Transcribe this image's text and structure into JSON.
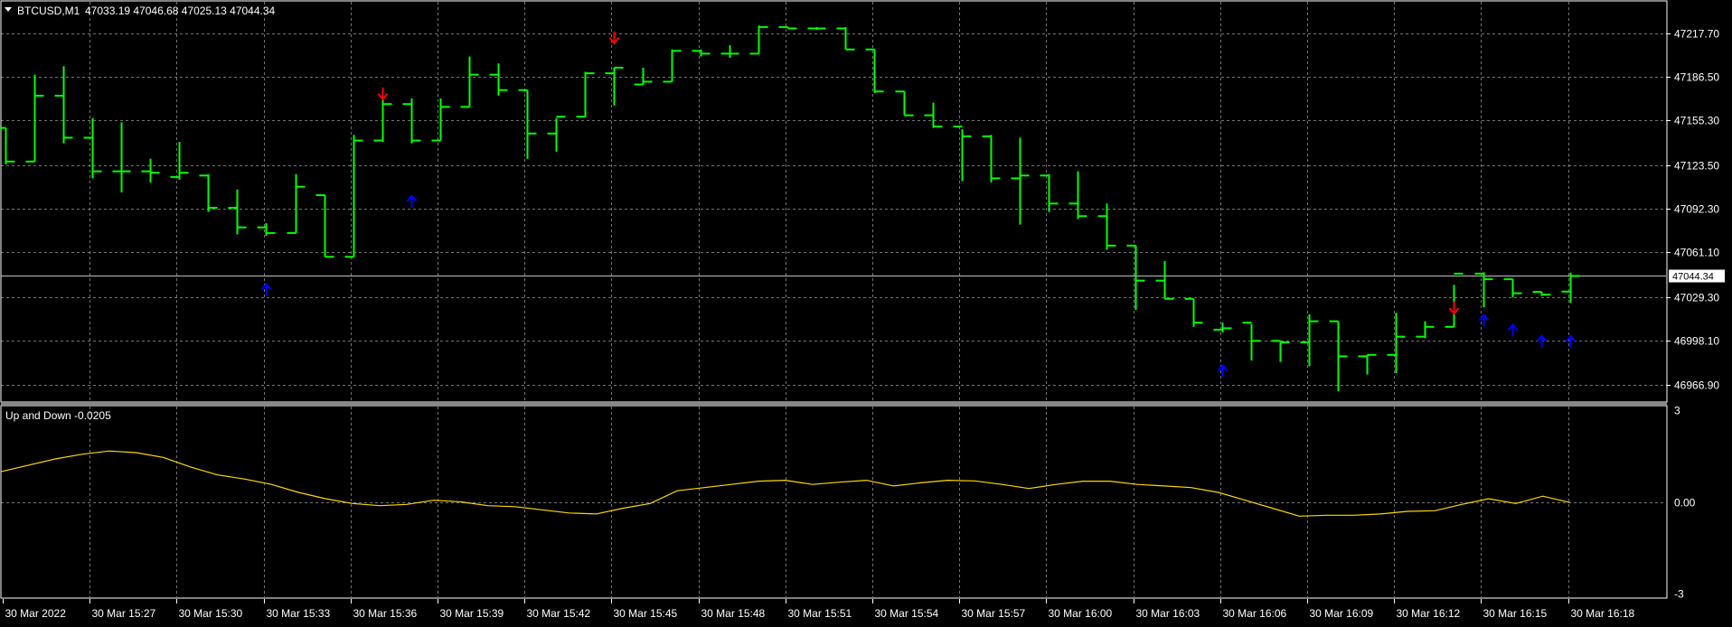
{
  "header": {
    "symbol_timeframe": "BTCUSD,M1",
    "ohlc": "47033.19 47046.68 47025.13 47044.34"
  },
  "indicator": {
    "label": "Up and Down -0.0205"
  },
  "colors": {
    "background": "#000000",
    "grid": "#c0c0c0",
    "bar": "#00ff00",
    "arrow_up": "#0000ff",
    "arrow_down": "#ff0000",
    "indicator_line": "#ffd700",
    "price_line": "#c0c0c0",
    "text": "#ffffff"
  },
  "chart_data": [
    {
      "type": "ohlc",
      "price_axis": {
        "ylim": [
          46955,
          47240
        ],
        "ticks": [
          "47217.70",
          "47186.50",
          "47155.30",
          "47123.50",
          "47092.30",
          "47061.10",
          "47029.30",
          "46998.10",
          "46966.90"
        ],
        "tick_values": [
          47217.7,
          47186.5,
          47155.3,
          47123.5,
          47092.3,
          47061.1,
          47029.3,
          46998.1,
          46966.9
        ],
        "current_price_label": "47044.34",
        "current_price": 47044.34
      },
      "bars": [
        {
          "o": 47150,
          "h": 47150,
          "l": 47124,
          "c": 47126
        },
        {
          "o": 47126,
          "h": 47188,
          "l": 47126,
          "c": 47173
        },
        {
          "o": 47173,
          "h": 47194,
          "l": 47139,
          "c": 47143
        },
        {
          "o": 47143,
          "h": 47157,
          "l": 47114,
          "c": 47119
        },
        {
          "o": 47119,
          "h": 47154,
          "l": 47104,
          "c": 47119
        },
        {
          "o": 47119,
          "h": 47128,
          "l": 47111,
          "c": 47118
        },
        {
          "o": 47115,
          "h": 47140,
          "l": 47113,
          "c": 47118
        },
        {
          "o": 47116,
          "h": 47117,
          "l": 47090,
          "c": 47093
        },
        {
          "o": 47093,
          "h": 47106,
          "l": 47074,
          "c": 47079
        },
        {
          "o": 47079,
          "h": 47082,
          "l": 47073,
          "c": 47075
        },
        {
          "o": 47075,
          "h": 47117,
          "l": 47075,
          "c": 47108
        },
        {
          "o": 47102,
          "h": 47102,
          "l": 47058,
          "c": 47058
        },
        {
          "o": 47058,
          "h": 47145,
          "l": 47058,
          "c": 47141
        },
        {
          "o": 47141,
          "h": 47172,
          "l": 47140,
          "c": 47167
        },
        {
          "o": 47167,
          "h": 47171,
          "l": 47139,
          "c": 47141
        },
        {
          "o": 47141,
          "h": 47171,
          "l": 47141,
          "c": 47165
        },
        {
          "o": 47165,
          "h": 47201,
          "l": 47165,
          "c": 47188
        },
        {
          "o": 47188,
          "h": 47196,
          "l": 47173,
          "c": 47177
        },
        {
          "o": 47177,
          "h": 47177,
          "l": 47128,
          "c": 47146
        },
        {
          "o": 47146,
          "h": 47157,
          "l": 47133,
          "c": 47158
        },
        {
          "o": 47158,
          "h": 47190,
          "l": 47158,
          "c": 47189
        },
        {
          "o": 47189,
          "h": 47193,
          "l": 47166,
          "c": 47193
        },
        {
          "o": 47181,
          "h": 47193,
          "l": 47181,
          "c": 47183
        },
        {
          "o": 47183,
          "h": 47206,
          "l": 47183,
          "c": 47205
        },
        {
          "o": 47205,
          "h": 47206,
          "l": 47201,
          "c": 47203
        },
        {
          "o": 47203,
          "h": 47209,
          "l": 47200,
          "c": 47203
        },
        {
          "o": 47203,
          "h": 47223,
          "l": 47203,
          "c": 47222
        },
        {
          "o": 47222,
          "h": 47222,
          "l": 47221,
          "c": 47221
        },
        {
          "o": 47221,
          "h": 47222,
          "l": 47220,
          "c": 47221
        },
        {
          "o": 47221,
          "h": 47222,
          "l": 47206,
          "c": 47206
        },
        {
          "o": 47206,
          "h": 47206,
          "l": 47175,
          "c": 47176
        },
        {
          "o": 47176,
          "h": 47176,
          "l": 47159,
          "c": 47159
        },
        {
          "o": 47159,
          "h": 47168,
          "l": 47150,
          "c": 47151
        },
        {
          "o": 47151,
          "h": 47149,
          "l": 47112,
          "c": 47144
        },
        {
          "o": 47144,
          "h": 47145,
          "l": 47111,
          "c": 47114
        },
        {
          "o": 47114,
          "h": 47143,
          "l": 47081,
          "c": 47116
        },
        {
          "o": 47116,
          "h": 47117,
          "l": 47090,
          "c": 47096
        },
        {
          "o": 47096,
          "h": 47119,
          "l": 47085,
          "c": 47087
        },
        {
          "o": 47087,
          "h": 47096,
          "l": 47063,
          "c": 47066
        },
        {
          "o": 47066,
          "h": 47066,
          "l": 47020,
          "c": 47041
        },
        {
          "o": 47041,
          "h": 47055,
          "l": 47028,
          "c": 47028
        },
        {
          "o": 47028,
          "h": 47028,
          "l": 47008,
          "c": 47011
        },
        {
          "o": 47006,
          "h": 47011,
          "l": 47004,
          "c": 47007
        },
        {
          "o": 47011,
          "h": 47010,
          "l": 46984,
          "c": 46998
        },
        {
          "o": 46998,
          "h": 46998,
          "l": 46983,
          "c": 46997
        },
        {
          "o": 46997,
          "h": 47017,
          "l": 46980,
          "c": 47012
        },
        {
          "o": 47012,
          "h": 47012,
          "l": 46962,
          "c": 46987
        },
        {
          "o": 46987,
          "h": 46988,
          "l": 46974,
          "c": 46988
        },
        {
          "o": 46988,
          "h": 47018,
          "l": 46975,
          "c": 47001
        },
        {
          "o": 47001,
          "h": 47012,
          "l": 47000,
          "c": 47008
        },
        {
          "o": 47008,
          "h": 47038,
          "l": 47008,
          "c": 47046
        },
        {
          "o": 47046,
          "h": 47047,
          "l": 47022,
          "c": 47042
        },
        {
          "o": 47042,
          "h": 47042,
          "l": 47029,
          "c": 47032
        },
        {
          "o": 47033,
          "h": 47033,
          "l": 47030,
          "c": 47031
        },
        {
          "o": 47033.19,
          "h": 47046.68,
          "l": 47025.13,
          "c": 47044.34
        }
      ],
      "signals": [
        {
          "bar": 13,
          "dir": "down",
          "price": 47175
        },
        {
          "bar": 14,
          "dir": "up",
          "price": 47097
        },
        {
          "bar": 9,
          "dir": "up",
          "price": 47034
        },
        {
          "bar": 21,
          "dir": "down",
          "price": 47215
        },
        {
          "bar": 42,
          "dir": "up",
          "price": 46976
        },
        {
          "bar": 50,
          "dir": "down",
          "price": 47022
        },
        {
          "bar": 51,
          "dir": "up",
          "price": 47012
        },
        {
          "bar": 52,
          "dir": "up",
          "price": 47005
        },
        {
          "bar": 53,
          "dir": "up",
          "price": 46997
        },
        {
          "bar": 54,
          "dir": "up",
          "price": 46997
        }
      ]
    },
    {
      "type": "line",
      "title": "Up and Down -0.0205",
      "ylim": [
        -3,
        3
      ],
      "ticks": [
        "3",
        "0.00",
        "-3"
      ],
      "tick_values": [
        3,
        0,
        -3
      ],
      "series": [
        {
          "values": [
            0.95,
            1.15,
            1.35,
            1.5,
            1.6,
            1.55,
            1.4,
            1.1,
            0.85,
            0.72,
            0.55,
            0.3,
            0.1,
            -0.05,
            -0.12,
            -0.08,
            0.05,
            0.0,
            -0.12,
            -0.15,
            -0.25,
            -0.35,
            -0.38,
            -0.2,
            -0.05,
            0.35,
            0.45,
            0.55,
            0.65,
            0.68,
            0.55,
            0.62,
            0.68,
            0.5,
            0.6,
            0.68,
            0.66,
            0.55,
            0.42,
            0.55,
            0.65,
            0.65,
            0.55,
            0.5,
            0.45,
            0.3,
            0.05,
            -0.2,
            -0.45,
            -0.42,
            -0.42,
            -0.38,
            -0.3,
            -0.28,
            -0.08,
            0.1,
            -0.05,
            0.18,
            -0.02
          ]
        }
      ]
    }
  ],
  "time_axis": {
    "labels": [
      "30 Mar 2022",
      "30 Mar 15:27",
      "30 Mar 15:30",
      "30 Mar 15:33",
      "30 Mar 15:36",
      "30 Mar 15:39",
      "30 Mar 15:42",
      "30 Mar 15:45",
      "30 Mar 15:48",
      "30 Mar 15:51",
      "30 Mar 15:54",
      "30 Mar 15:57",
      "30 Mar 16:00",
      "30 Mar 16:03",
      "30 Mar 16:06",
      "30 Mar 16:09",
      "30 Mar 16:12",
      "30 Mar 16:15",
      "30 Mar 16:18"
    ]
  }
}
